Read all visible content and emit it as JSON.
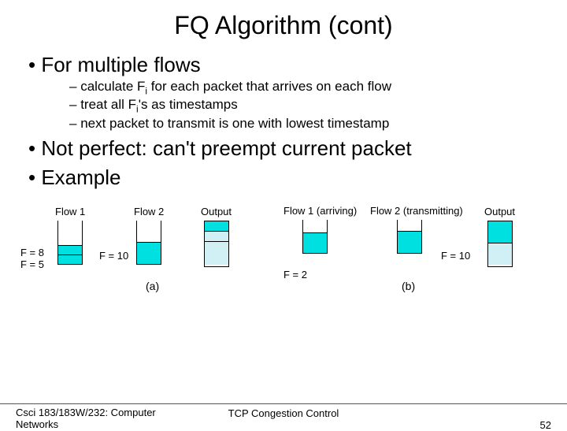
{
  "title": "FQ Algorithm (cont)",
  "bullets": {
    "b1": "For multiple flows",
    "s1": "calculate F",
    "s1b": " for each packet that arrives on each flow",
    "s2a": "treat all F",
    "s2b": "'s as timestamps",
    "s3": "next packet to transmit is one with lowest timestamp",
    "b2": "Not perfect: can't preempt current packet",
    "b3": "Example"
  },
  "diagram": {
    "colA1": "Flow 1",
    "colA2": "Flow 2",
    "colA3": "Output",
    "f8": "F = 8",
    "f5": "F = 5",
    "f10a": "F = 10",
    "captionA": "(a)",
    "colB1": "Flow 1 (arriving)",
    "colB2": "Flow 2 (transmitting)",
    "colB3": "Output",
    "f10b": "F = 10",
    "f2": "F = 2",
    "captionB": "(b)"
  },
  "footer": {
    "left": "Csci 183/183W/232: Computer Networks",
    "center": "TCP Congestion Control",
    "right": "52"
  }
}
